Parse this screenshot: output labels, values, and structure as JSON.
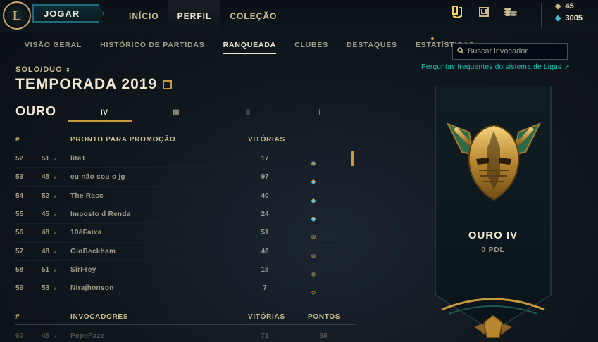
{
  "topbar": {
    "logo_label": "L",
    "play_label": "JOGAR",
    "nav": [
      {
        "label": "INÍCIO",
        "active": false
      },
      {
        "label": "PERFIL",
        "active": true
      },
      {
        "label": "COLEÇÃO",
        "active": false
      }
    ],
    "icons": [
      "missions-icon",
      "loot-icon",
      "store-icon"
    ],
    "currency": {
      "rp": "45",
      "be": "3005"
    }
  },
  "subnav": {
    "items": [
      {
        "label": "VISÃO GERAL",
        "active": false
      },
      {
        "label": "HISTÓRICO DE PARTIDAS",
        "active": false
      },
      {
        "label": "RANQUEADA",
        "active": true
      },
      {
        "label": "CLUBES",
        "active": false
      },
      {
        "label": "DESTAQUES",
        "active": false
      },
      {
        "label": "ESTATÍSTICAS",
        "active": false
      }
    ]
  },
  "search": {
    "placeholder": "Buscar invocador"
  },
  "faq_link": "Perguntas frequentes do sistema de Ligas ↗",
  "ranked": {
    "queue": "SOLO/DUO",
    "season": "TEMPORADA 2019",
    "tier": "OURO",
    "divisions": [
      {
        "label": "IV",
        "active": true
      },
      {
        "label": "III",
        "active": false
      },
      {
        "label": "II",
        "active": false
      },
      {
        "label": "I",
        "active": false
      }
    ]
  },
  "promo_table": {
    "headers": {
      "rank": "#",
      "section": "PRONTO PARA PROMOÇÃO",
      "wins": "VITÓRIAS"
    },
    "rows": [
      {
        "rank": "52",
        "level": "51",
        "name": "lite1",
        "wins": "17",
        "series": [
          "win",
          "loss",
          "empty"
        ]
      },
      {
        "rank": "53",
        "level": "48",
        "name": "eu não sou o jg",
        "wins": "97",
        "series": [
          "win",
          "empty",
          "empty"
        ]
      },
      {
        "rank": "54",
        "level": "52",
        "name": "The Racc",
        "wins": "40",
        "series": [
          "win",
          "empty",
          "empty"
        ]
      },
      {
        "rank": "55",
        "level": "45",
        "name": "Imposto d Renda",
        "wins": "24",
        "series": [
          "win",
          "empty",
          "empty"
        ]
      },
      {
        "rank": "56",
        "level": "48",
        "name": "10éFaixa",
        "wins": "51",
        "series": [
          "loss",
          "empty",
          "empty"
        ]
      },
      {
        "rank": "57",
        "level": "48",
        "name": "GioBeckham",
        "wins": "46",
        "series": [
          "loss",
          "empty",
          "empty"
        ]
      },
      {
        "rank": "58",
        "level": "51",
        "name": "SirFrey",
        "wins": "18",
        "series": [
          "loss",
          "empty",
          "empty"
        ]
      },
      {
        "rank": "59",
        "level": "53",
        "name": "Nirajhonson",
        "wins": "7",
        "series": [
          "empty",
          "empty",
          "empty"
        ]
      }
    ]
  },
  "summoner_table": {
    "headers": {
      "rank": "#",
      "section": "INVOCADORES",
      "wins": "VITÓRIAS",
      "points": "PONTOS"
    },
    "rows": [
      {
        "rank": "60",
        "level": "46",
        "name": "PepeFaze",
        "wins": "71",
        "points": "98"
      }
    ]
  },
  "rank_card": {
    "title": "OURO IV",
    "lp": "0 PDL"
  },
  "colors": {
    "gold": "#c89b3c",
    "gold_light": "#f0e6d2",
    "teal": "#0ac8b9",
    "win": "#4fd8ec"
  }
}
